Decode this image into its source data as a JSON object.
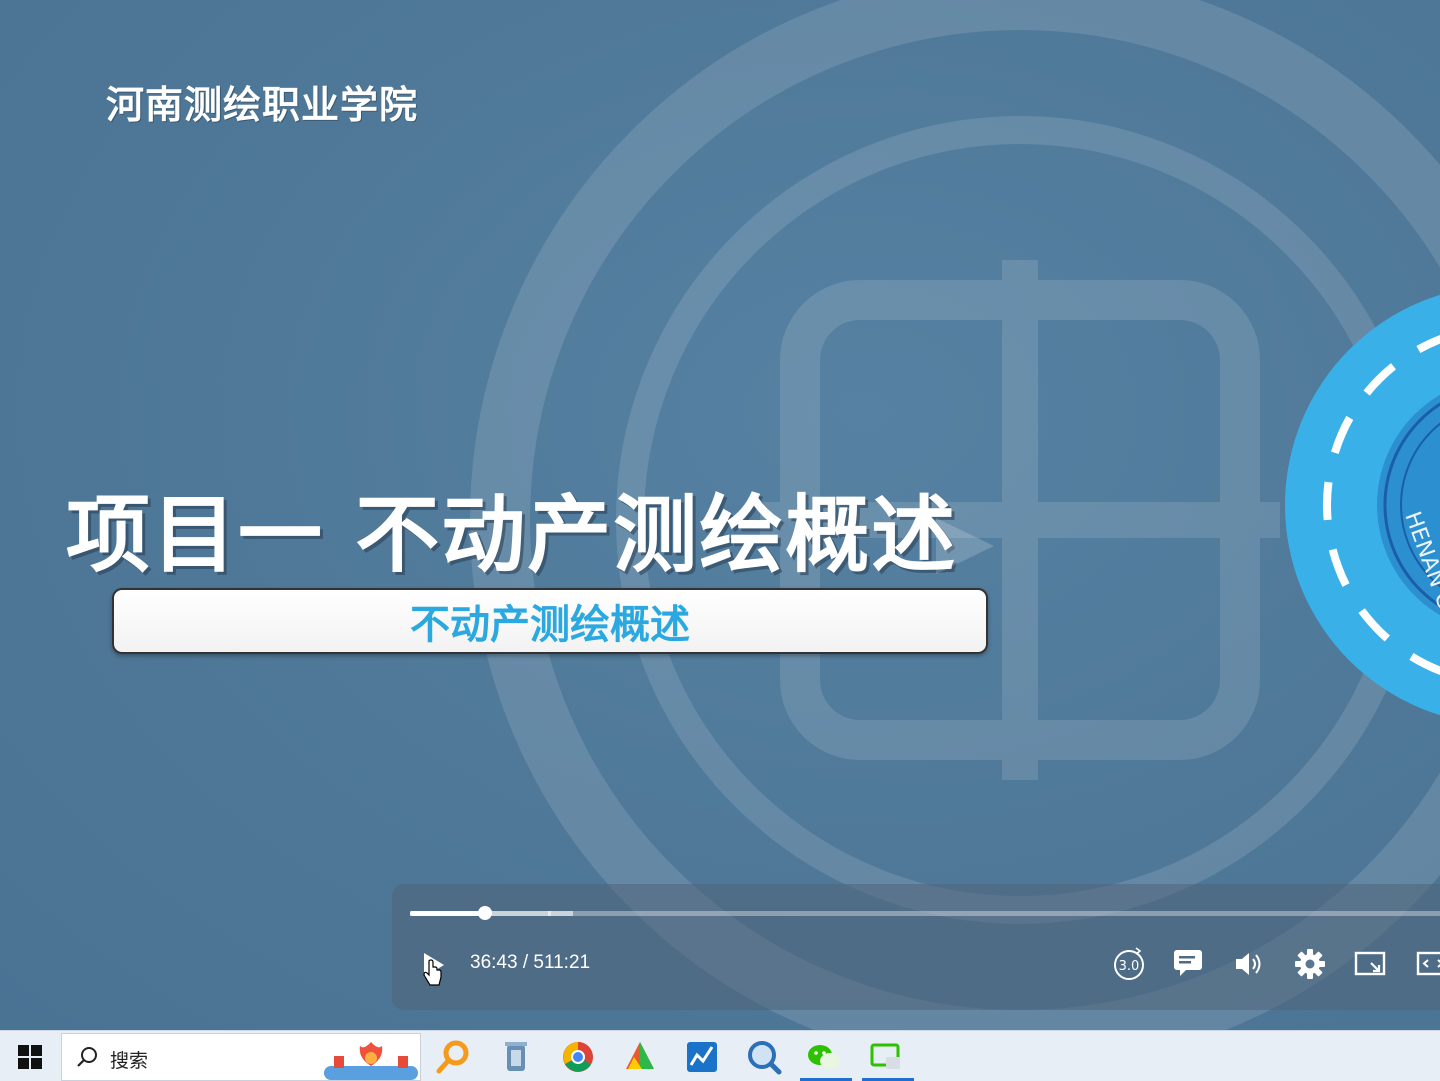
{
  "slide": {
    "school_name": "河南测绘职业学院",
    "title": "项目一 不动产测绘概述",
    "subtitle": "不动产测绘概述",
    "emblem_text": "HENAN COLL"
  },
  "player": {
    "time_display": "36:43 / 511:21",
    "progress_fraction": 0.0718,
    "buffered_fraction": 0.155,
    "speed_label": "3.0",
    "state": "paused"
  },
  "taskbar": {
    "search_placeholder": "搜索",
    "apps": [
      {
        "name": "search-app-icon",
        "color": "#f59b1b"
      },
      {
        "name": "recycle-bin-icon",
        "color": "#6a8fb5"
      },
      {
        "name": "chrome-icon",
        "color": "#db4437"
      },
      {
        "name": "color-app-icon",
        "color": "#e65c2e"
      },
      {
        "name": "chart-app-icon",
        "color": "#1a73c8"
      },
      {
        "name": "magnifier-app-icon",
        "color": "#2a6fb8"
      },
      {
        "name": "wechat-icon",
        "color": "#2dc100"
      },
      {
        "name": "screen-app-icon",
        "color": "#2dc100"
      }
    ]
  },
  "colors": {
    "accent_blue": "#2ba8e0",
    "background": "#4f7898",
    "taskbar_active": "#1f6fd1"
  }
}
